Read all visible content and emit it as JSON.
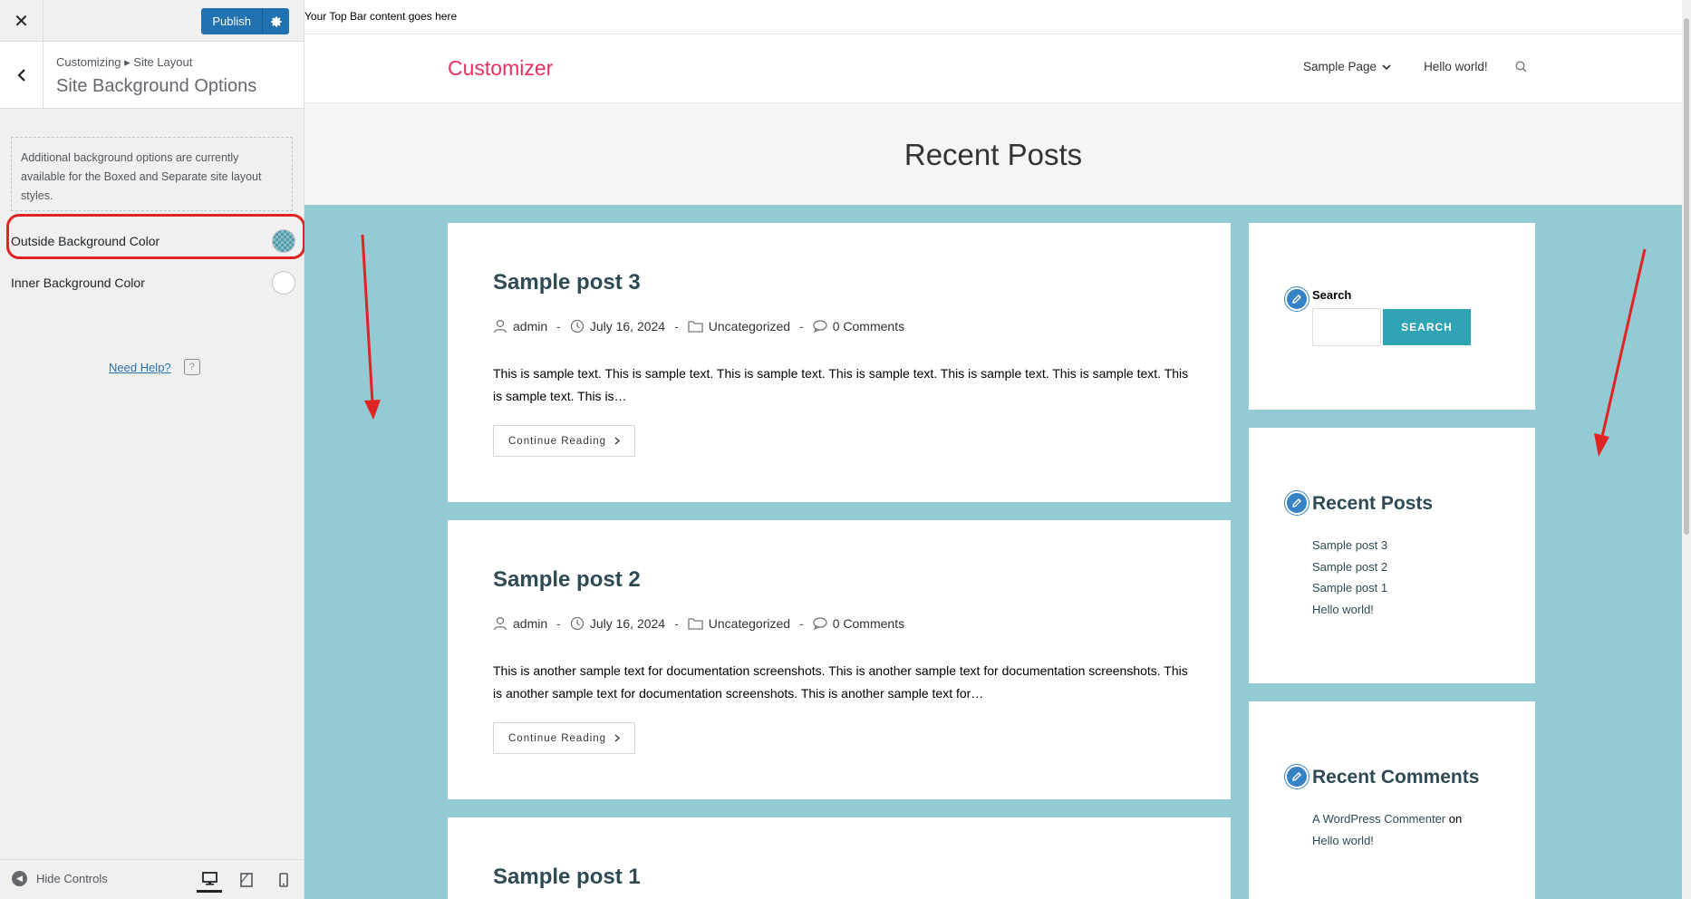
{
  "sidebar": {
    "close_symbol": "✕",
    "publish_label": "Publish",
    "breadcrumb": "Customizing ▸ Site Layout",
    "section_title": "Site Background Options",
    "notice": "Additional background options are currently available for the Boxed and Separate site layout styles.",
    "outside_bg_label": "Outside Background Color",
    "outside_bg_color": "#4f9aa8",
    "inner_bg_label": "Inner Background Color",
    "inner_bg_color": "#ffffff",
    "help_label": "Need Help?",
    "help_icon_glyph": "?",
    "hide_controls_label": "Hide Controls",
    "hide_icon_glyph": "◀",
    "devices": [
      "desktop-icon",
      "tablet-icon",
      "mobile-icon"
    ]
  },
  "preview": {
    "top_bar_text": "Your Top Bar content goes here",
    "site_title": "Customizer",
    "nav": {
      "sample_page": "Sample Page",
      "hello_world": "Hello world!"
    },
    "page_title": "Recent Posts",
    "posts": [
      {
        "title": "Sample post 3",
        "author": "admin",
        "date": "July 16, 2024",
        "category": "Uncategorized",
        "comments": "0 Comments",
        "excerpt": "This is sample text. This is sample text. This is sample text. This is sample text. This is sample text. This is sample text. This is sample text. This is…",
        "continue_label": "Continue Reading"
      },
      {
        "title": "Sample post 2",
        "author": "admin",
        "date": "July 16, 2024",
        "category": "Uncategorized",
        "comments": "0 Comments",
        "excerpt": "This is another sample text for documentation screenshots. This is another sample text for documentation screenshots. This is another sample text for documentation screenshots. This is another sample text for…",
        "continue_label": "Continue Reading"
      },
      {
        "title": "Sample post 1"
      }
    ],
    "widgets": {
      "search": {
        "label": "Search",
        "button": "SEARCH"
      },
      "recent_posts": {
        "title": "Recent Posts",
        "items": [
          "Sample post 3",
          "Sample post 2",
          "Sample post 1",
          "Hello world!"
        ]
      },
      "recent_comments": {
        "title": "Recent Comments",
        "commenter": "A WordPress Commenter",
        "on_word": "on",
        "post": "Hello world!"
      }
    },
    "colors": {
      "accent_title": "#e8305e",
      "outside_bg": "#93cad4",
      "search_button": "#2ea4b5",
      "annotation": "#e02424"
    }
  }
}
